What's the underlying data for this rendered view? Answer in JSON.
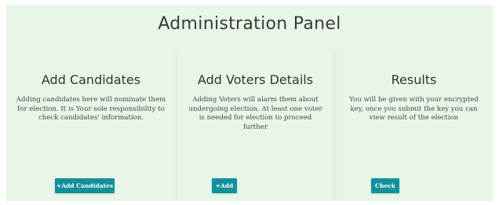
{
  "panel": {
    "title": "Administration Panel"
  },
  "columns": [
    {
      "heading": "Add Candidates",
      "description": "Adding candidates here will nominate them for election. It is Your sole responsibility to check candidates' information.",
      "button_label": "+Add Candidates"
    },
    {
      "heading": "Add Voters Details",
      "description": "Adding Voters will alarm them about undergoing election. At least one voter is needed for election to proceed further",
      "button_label": "+Add"
    },
    {
      "heading": "Results",
      "description": "You will be given with your encrypted key, once you submit the key you can view result of the election",
      "button_label": "Check"
    }
  ],
  "colors": {
    "background": "#e8f6e8",
    "button": "#12909c",
    "button_text": "#ffffff"
  }
}
